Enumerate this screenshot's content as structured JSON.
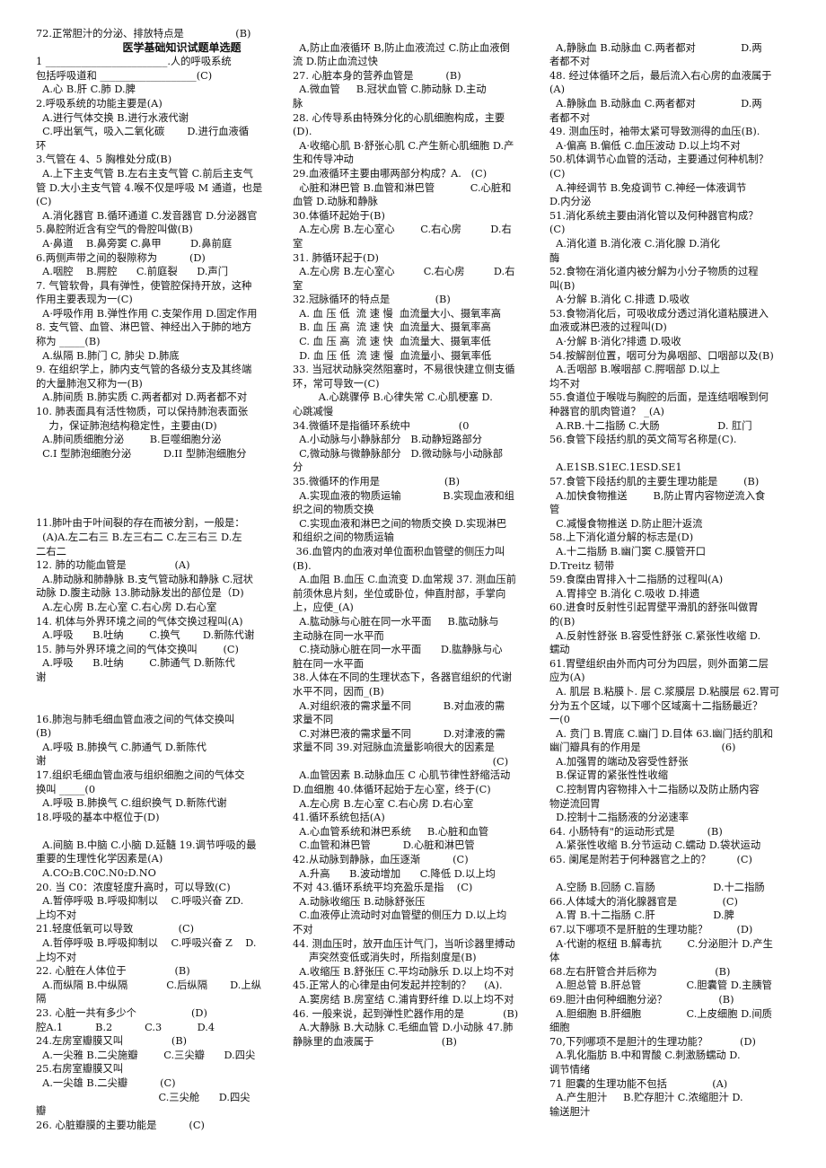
{
  "document": {
    "title": "医学基础知识试题单选题",
    "left_column": [
      "72.正常胆汁的分泌、排放特点是                (B)",
      "@title",
      "1 ________________________.人的呼吸系统",
      "包括呼吸道和 ___________________(C)",
      "  A.心 B.肝 C.肺 D.脾",
      "2.呼吸系统的功能主要是(A)",
      "  A.进行气体交换 B.进行水液代谢",
      "  C.呼出氧气，吸入二氧化碳       D.进行血液循",
      "环",
      "3.气管在 4、5 胸椎处分成(B)",
      "  A.上下主支气管 B.左右主支气管 C.前后主支气",
      "管 D.大小主支气管 4.喉不仅是呼吸 M 通道，也是",
      "(C)",
      "  A.消化器官 B.循环通道 C.发音器官 D.分泌器官",
      "5.鼻腔附近含有空气的骨腔叫做(B)",
      "  A·鼻道    B.鼻旁窦 C.鼻甲         D.鼻前庭",
      "6.两侧声带之间的裂隙称为          (D)",
      "  A.咽腔    B.腭腔      C.前庭裂      D.声门",
      "7. 气管软骨，具有弹性，使管腔保持开放，这种",
      "作用主要表现为一(C)",
      "  A·呼吸作用 B.弹性作用 C.支架作用 D.固定作用",
      "8. 支气管、血管、淋巴管、神经出入于肺的地方",
      "称为 _____(B)",
      "  A.纵隔 B.肺门 C, 肺尖 D.肺底",
      "9. 在组织学上，肺内支气管的各级分支及其终端",
      "的大量肺泡又称为一(B)",
      "  A.肺间质 B.肺实质 C.两者都对 D.两者都不对",
      "10. 肺表面具有活性物质，可以保持肺泡表面张",
      "    力，保证肺泡结构稳定性，主要由(D)",
      "  A.肺间质细胞分泌        B.巨噬细胞分泌",
      "  C.I 型肺泡细胞分泌          D.II 型肺泡细胞分",
      "@gapXL",
      "11.肺叶由于叶间裂的存在而被分割，一般是：",
      "  (A)A.左二右三 B.左三右二 C.左三右三 D.左",
      "二右二",
      "12. 肺的功能血管是               (A)",
      "  A.肺动脉和肺静脉 B.支气管动脉和静脉 C.冠状",
      "动脉 D.腹主动脉 13.肺动脉发出的部位是（D)",
      "  A.左心房 B.左心室 C.右心房 D.右心室",
      "14. 机体与外界环境之间的气体交换过程叫(A)",
      "  A.呼吸      B.吐纳        C.换气       D.新陈代谢",
      "15. 肺与外界环境之间的气体交换叫        (C)",
      "  A.呼吸      B.吐纳        C.肺通气 D.新陈代",
      "谢",
      "@gapL",
      "16.肺泡与肺毛细血管血液之间的气体交换叫",
      "(B)",
      "  A.呼吸 B.肺换气 C.肺通气 D.新陈代",
      "谢",
      "17.组织毛细血管血液与组织细胞之间的气体交",
      "换叫 _____(0",
      "  A.呼吸 B.肺换气 C.组织换气 D.新陈代谢",
      "18.呼吸的基本中枢位于(D)",
      "@gap",
      "  A.间脑 B.中脑 C.小脑 D.延髓 19.调节呼吸的最",
      "重要的生理性化学因素是(A)",
      "  A.CO₂B.C0C.N0₂D.NO",
      "20. 当 C0：浓度轻度升高时，可以导致(C)",
      "  A.暂停呼吸 B.呼吸抑制以    C.呼吸兴奋 ZD.",
      "上均不对",
      "21.轻度低氧可以导致              (C)",
      "  A.哲停呼吸 B.呼吸抑制以    C.呼吸兴奋 Z    D.",
      "上均不对",
      "22. 心脏在人体位于               (B)",
      "  A.而纵隔 B.中纵隔            C.后纵隔       D.上纵",
      "隔",
      "23. 心脏一共有多少个                 (D)",
      "腔A.1          B.2          C.3           D.4",
      "24.左房室瓣膜又叫               (B)",
      "  A.一尖雅 B.二尖施瓣        C.三尖瓣      D.四尖",
      "25.右房室瓣膜又叫",
      "  A.一尖雄 B.二尖瓣          (C)",
      "                                      C.三尖舱      D.四尖",
      "瓣",
      "26. 心脏瓣膜的主要功能是          (C)"
    ],
    "middle_column": [
      "@gap",
      "  A,防止血液循环 B,防止血液流过 C.防止血液倒",
      "流 D.防止血流过快",
      "27. 心脏本身的营养血管是          (B)",
      "  A.微血管     B.冠状血管 C.肺动脉 D.主动",
      "脉",
      "28. 心传导系由特殊分化的心肌细胞构成，主要",
      "(D).",
      "  A·收缩心肌 B·舒张心肌 C.产生新心肌细胞 D.产",
      "生和传导冲动",
      "29.血液循环主要由哪两部分构成？A.   (C)",
      "  心脏和淋巴管 B.血管和淋巴管           C.心脏和",
      "血管 D.动脉和静脉",
      "30.体循环起始于(B)",
      "  A.左心房 B.左心室心        C.右心房         D.右",
      "室",
      "31. 肺循环起于(D)",
      "  A.左心房 B.左心室心         C.右心房         D.右",
      "室",
      "32.冠脉循环的特点是              (B)",
      "  A. 血 压 低  流 速 慢  血流量大小、摄氧率高",
      "  B. 血 压 高  流 速 快  血流量大、摄氧率高",
      "  C. 血 压 高  流 速 快  血流量大、摄氧率低",
      "  D. 血 压 低  流 速 慢  血流量小、摄氧率低",
      "33. 当冠状动脉突然阻塞时，不易很快建立侧支循",
      "环，常可导致一(C)",
      "        A.心跳骤停 B.心律失常 C.心肌梗塞 D.",
      "心跳减慢",
      "34.微循环是指循环系统中               (0",
      "  A.小动脉与小静脉部分   B.动静短路部分",
      "  C,微动脉与微静脉部分   D.微动脉与小动脉部",
      "分",
      "35.微循环的作用是                    (B)",
      "  A.实现血液的物质运输             B.实现血液和组",
      "织之间的物质交换",
      "  C.实现血液和淋巴之间的物质交换 D.实现淋巴",
      "和组织之间的物质运输",
      " 36.血管内的血液对单位面积血管壁的侧压力叫",
      "(B).",
      "  A.血阻 B.血压 C.血流变 D.血常规 37. 测血压前",
      "前须休息片刻，坐位或卧位，伸直肘部，手掌向",
      "上，应使_(A)",
      "  A.肱动脉与心脏在同一水平面     B.肱动脉与",
      "主动脉在同一水平而",
      "  C.挠动脉心脏在同一水平面      D.肱静脉与心",
      "脏在同一水平面",
      "38.人体在不同的生理状态下，各器官组织的代谢",
      "水平不同，因而_(B)",
      "  A.对组织液的需求量不同          B.对血液的需",
      "求量不同",
      "  C.对淋巴液的需求量不同          D.对津液的需",
      "求量不同 39.对冠脉血流量影响很大的因素是",
      "                                                              (C)",
      "  A.血管因素 B.动脉血压 C 心肌节律性舒缩活动",
      "D.血细胞 40.体循环起始于左心室，终于(C)",
      "  A.左心房 B.左心室 C.右心房 D.右心室",
      "41.循环系统包括(A)",
      "  A.心血管系统和淋巴系统     B.心脏和血管",
      "  C.血管和淋巴管          D.心脏和淋巴管",
      "42.从动脉到静脉，血压逐渐          (C)",
      "  A.升高      B.波动增加      C.降低 D.以上均",
      "不对 43.循环系统平均充盈乐是指    (C)",
      "  A.动脉收缩压 B.动脉舒张压",
      "  C.血液停止流动时对血管壁的侧压力 D.以上均",
      "不对",
      "44. 测血压时，放开血压计气门，当听诊器里搏动",
      "     声突然变低或消失时，所指刻度是(B)",
      "  A.收缩压 B.舒张压 C.平均动脉乐 D.以上均不对",
      "45.正常人的心律是由何发起并控制的？    (A).",
      "  A.窦房结 B.房室结 C.浦肯野纤维 D.以上均不对",
      "46. 一般来说，起到弹性贮器作用的是            (B)",
      "  A.大静脉 B.大动脉 C.毛细血管 D.小动脉 47.肺",
      "静脉里的血液属于                     (B)"
    ],
    "right_column": [
      "@gap",
      "  A,静脉血 B.动脉血 C.两者都对              D.两",
      "者都不对",
      "48. 经过体循环之后，最后流入右心房的血液属于",
      "(A)",
      "  A.静脉血 B.动脉血 C.两者都对              D.两",
      "者都不对",
      "49. 测血压时，袖带太紧可导致测得的血压(B).",
      "  A·偏高 B.偏低 C.血压波动 D.以上均不对",
      "50.机体调节心血管的活动，主要通过何种机制？",
      "(C)",
      "  A.神经调节 B.免疫调节 C.神经一体液调节",
      "D.内分泌",
      "51.消化系统主要由消化管以及何种器官构成？",
      "(C)",
      "  A.消化道 B.消化液 C.消化腺 D.消化",
      "酶",
      "52.食物在消化道内被分解为小分子物质的过程",
      "叫(B)",
      "  A·分解 B.消化 C.排遗 D.吸收",
      "53.食物消化后，可吸收成分透过消化道粘膜进入",
      "血液或淋巴液的过程叫(D)",
      "  A·分解 B·消化?排遗 D.吸收",
      "54.按解剖位置，咽可分为鼻咽部、口咽部以及(B)",
      "  A.舌咽部 B.喉咽部 C.腭咽部 D.以上",
      "均不对",
      "55.食道位于喉咙与胸腔的后面，是连结咽喉到何",
      "种器官的肌肉管道？ _(A)",
      "  A.RB.十二指肠 C.大肠                  D. 肛门",
      "56.食管下段括约肌的英文简写名称是(C).",
      "@gap",
      "  A.E1SB.S1EC.1ESD.SE1",
      "57.食管下段括约肌的主要生理功能是        (B)",
      "  A.加快食物推送        B,防止胃内容物逆流入食",
      "管",
      "  C.减慢食物推送 D.防止胆汁返流",
      "58.上下消化道分解的标志是(D)",
      "  A.十二指肠 B.幽门窦 C.膜管开口",
      "D.Treitz 韧带",
      "59.食糜由胃排入十二指肠的过程叫(A)",
      "  A.胃排空 B.消化 C.吸收 D.排遗",
      "60.进食时反射性引起胃壁平滑肌的舒张叫做胃",
      "的(B)",
      "  A.反射性舒张 B.容受性舒张 C.紧张性收缩 D.",
      "蠕动",
      "61.胃壁组织由外而内可分为四层，则外面第二层",
      "应为(A)",
      "  A. 肌层 B.粘膜卜. 层 C.浆膜层 D.粘膜层 62.胃可",
      "分为五个区域，以下哪个区域离十二指肠最近？",
      "一(0",
      "  A. 贲门 B.胃底 C.幽门 D.目体 63.幽门括约肌和",
      "幽门瓣具有的作用是                         (6)",
      "  A.加强胃的端动及容受性舒张",
      "  B.保证胃的紧张性性收缩",
      "  C.控制胃内容物排入十二指肠以及防止肠内容",
      "物逆流回胃",
      "  D.控制十二指肠液的分泌速率",
      "64. 小肠特有\"的运动形式是          (B)",
      "  A.紧张性收缩 B.分节运动 C.蠕动 D.袋状运动",
      "65. 阑尾是附若于何种器官之上的？        (C)",
      "@gap",
      "  A.空肠 B.回肠 C.盲肠                  D.十二指肠",
      "66.人体域大的消化腺器官是              (C)",
      "  A.胃 B.十二指肠 C.肝                  D.脾",
      "67.以下哪项不是肝脏的生理功能？         (D)",
      "  A·代谢的枢纽 B.解毒抗        C.分泌胆汁 D.产生",
      "体",
      "68.左右肝管合并后称为                  (B)",
      "  A.胆总管 B.肝总管              C.胆囊管 D.主胰管",
      "69.胆汁由何种细胞分泌？                (B)",
      "  A.胆细胞 B.肝细胞              C.上皮细胞 D.间质",
      "细胞",
      "70,下列哪项不是胆汁的生理功能？          (D)",
      "  A.乳化脂肪 B.中和胃酸 C.刺激肠蠕动 D.",
      "调节情绪",
      "71 胆囊的生理功能不包括              (A)",
      "  A.产生胆汁     B.贮存胆汁 C.浓缩胆汁 D.",
      "输送胆汁"
    ]
  }
}
